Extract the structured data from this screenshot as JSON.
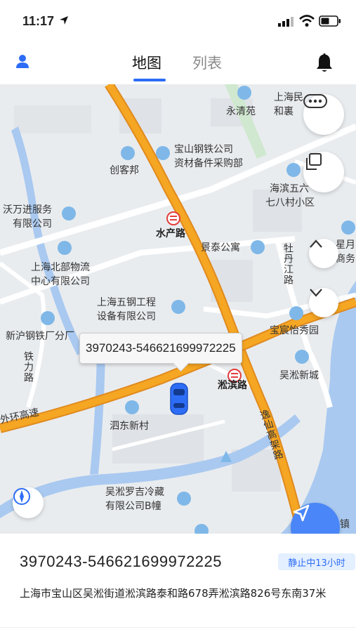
{
  "status_bar": {
    "time": "11:17"
  },
  "nav": {
    "tabs": [
      {
        "label": "地图",
        "active": true
      },
      {
        "label": "列表",
        "active": false
      }
    ]
  },
  "map": {
    "labels": [
      "上海民",
      "和裏",
      "永清苑",
      "宝山钢铁公司",
      "资材备件采购部",
      "创客邦",
      "海滨五六",
      "七八村小区",
      "沃万进服务",
      "有限公司",
      "水产路",
      "景泰公寓",
      "星月",
      "商务",
      "牡丹江路",
      "上海北部物流",
      "中心有限公司",
      "上海五钢工程",
      "设备有限公司",
      "新沪钢铁厂分厂",
      "宝宸怡秀园",
      "吴淞新城",
      "铁力路",
      "淞滨路",
      "外环高速",
      "泗东新村",
      "逸仙高架路",
      "吴淞罗吉冷藏",
      "有限公司B幢",
      "镇"
    ],
    "vehicle_tooltip": "3970243-546621699972225"
  },
  "colors": {
    "accent": "#2d6df6",
    "highway": "#f5a623",
    "water": "#a9c9f0",
    "green": "#cfe8cf"
  },
  "vehicle": {
    "plate": "3970243-546621699972225",
    "status": "静止中13小时",
    "address": "上海市宝山区吴淞街道淞滨路泰和路678弄淞滨路826号东南37米"
  }
}
